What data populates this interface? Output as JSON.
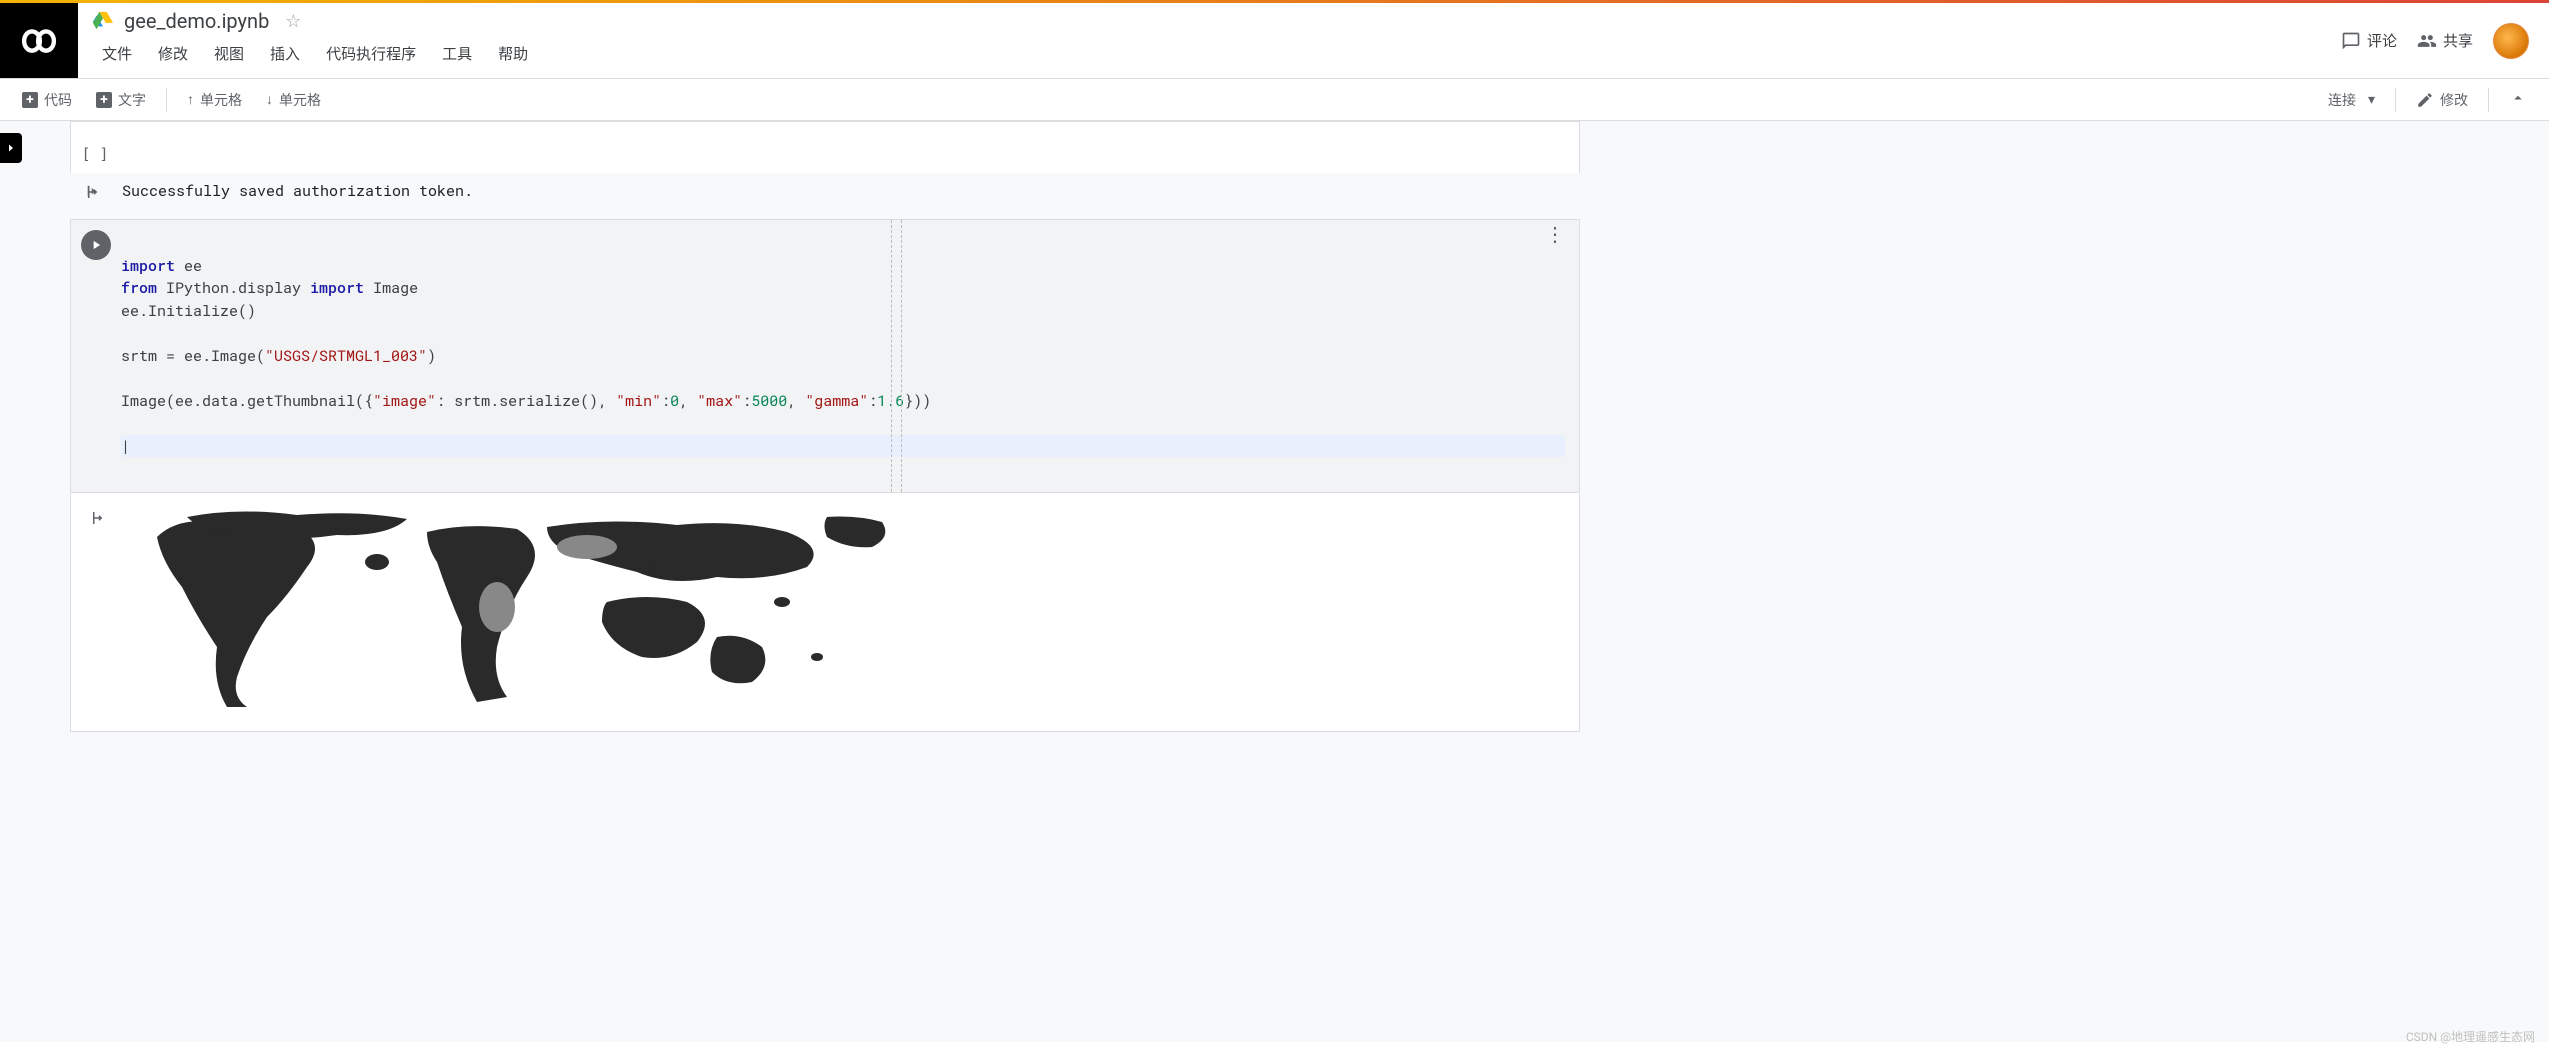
{
  "doc": {
    "title": "gee_demo.ipynb"
  },
  "menus": {
    "file": "文件",
    "edit": "修改",
    "view": "视图",
    "insert": "插入",
    "runtime": "代码执行程序",
    "tools": "工具",
    "help": "帮助"
  },
  "header_actions": {
    "comment": "评论",
    "share": "共享"
  },
  "toolbar": {
    "code": "代码",
    "text": "文字",
    "cell_up": "单元格",
    "cell_down": "单元格",
    "connect": "连接",
    "editing": "修改"
  },
  "cells": {
    "prev_bracket": "[  ]",
    "auth_output": "Successfully saved authorization token.",
    "code_lines": {
      "l1a": "import",
      "l1b": " ee",
      "l2a": "from",
      "l2b": " IPython.display ",
      "l2c": "import",
      "l2d": " Image",
      "l3": "ee.Initialize()",
      "l4": "",
      "l5a": "srtm = ee.Image(",
      "l5b": "\"USGS/SRTMGL1_003\"",
      "l5c": ")",
      "l6": "",
      "l7a": "Image(ee.data.getThumbnail({",
      "l7b": "\"image\"",
      "l7c": ": srtm.serialize(), ",
      "l7d": "\"min\"",
      "l7e": ":",
      "l7f": "0",
      "l7g": ", ",
      "l7h": "\"max\"",
      "l7i": ":",
      "l7j": "5000",
      "l7k": ", ",
      "l7l": "\"gamma\"",
      "l7m": ":",
      "l7n": "1.6",
      "l7o": "}))"
    }
  },
  "watermark": "CSDN @地理遥感生态网"
}
